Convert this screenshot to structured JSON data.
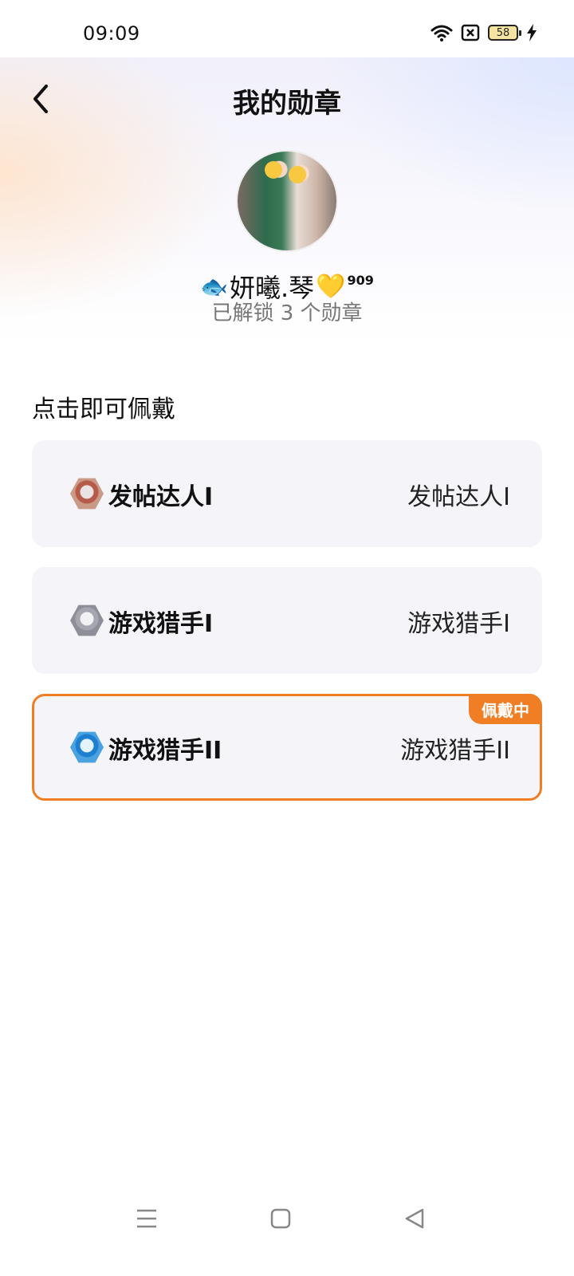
{
  "status_bar": {
    "time": "09:09",
    "battery_level": "58",
    "icons": [
      "wifi-icon",
      "sim-blocked-icon",
      "battery-icon",
      "charging-icon"
    ]
  },
  "header": {
    "title": "我的勋章",
    "back_icon": "back-arrow-icon"
  },
  "profile": {
    "username": "妍曦.琴",
    "prefix_emoji": "🐟",
    "suffix_emoji": "💛",
    "level": "909",
    "unlocked_text": "已解锁 3 个勋章"
  },
  "section": {
    "label": "点击即可佩戴"
  },
  "badges": [
    {
      "name": "发帖达人I",
      "desc": "发帖达人I",
      "icon": "post-master-badge-icon",
      "color": "#c99a86",
      "active": false
    },
    {
      "name": "游戏猎手I",
      "desc": "游戏猎手I",
      "icon": "game-hunter-badge-icon",
      "color": "#8e8e98",
      "active": false
    },
    {
      "name": "游戏猎手II",
      "desc": "游戏猎手II",
      "icon": "game-hunter-2-badge-icon",
      "color": "#4aa3e0",
      "active": true,
      "tag": "佩戴中"
    }
  ],
  "colors": {
    "accent": "#f07e25",
    "card_bg": "#f4f4f9"
  },
  "nav_bar": {
    "icons": [
      "menu-icon",
      "home-icon",
      "back-icon"
    ]
  }
}
